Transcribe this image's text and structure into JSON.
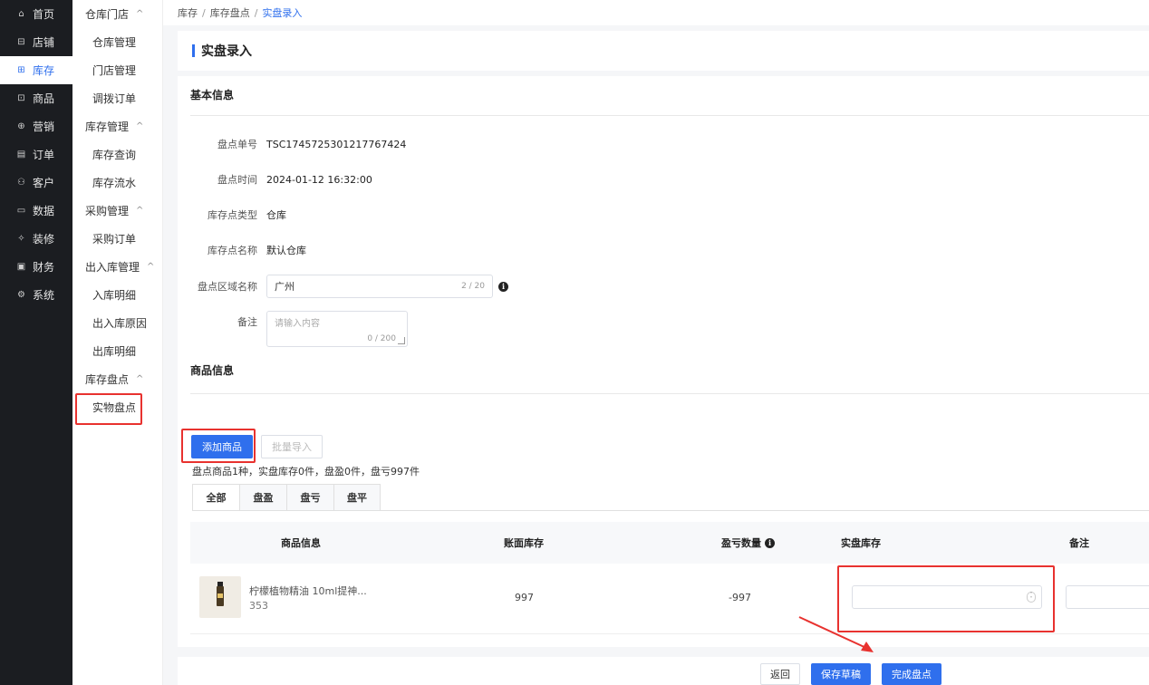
{
  "sidebar": {
    "items": [
      {
        "label": "首页",
        "icon": "home-icon",
        "glyph": "⌂"
      },
      {
        "label": "店铺",
        "icon": "store-icon",
        "glyph": "⊟"
      },
      {
        "label": "库存",
        "icon": "inventory-icon",
        "glyph": "⊞"
      },
      {
        "label": "商品",
        "icon": "goods-icon",
        "glyph": "⊡"
      },
      {
        "label": "营销",
        "icon": "marketing-icon",
        "glyph": "⊕"
      },
      {
        "label": "订单",
        "icon": "order-icon",
        "glyph": "▤"
      },
      {
        "label": "客户",
        "icon": "customer-icon",
        "glyph": "⚇"
      },
      {
        "label": "数据",
        "icon": "data-icon",
        "glyph": "▭"
      },
      {
        "label": "装修",
        "icon": "decorate-icon",
        "glyph": "✧"
      },
      {
        "label": "财务",
        "icon": "finance-icon",
        "glyph": "▣"
      },
      {
        "label": "系统",
        "icon": "system-icon",
        "glyph": "⚙"
      }
    ],
    "active": "库存"
  },
  "subnav": {
    "groups": [
      {
        "label": "仓库门店",
        "items": [
          "仓库管理",
          "门店管理",
          "调拨订单"
        ]
      },
      {
        "label": "库存管理",
        "items": [
          "库存查询",
          "库存流水"
        ]
      },
      {
        "label": "采购管理",
        "items": [
          "采购订单"
        ]
      },
      {
        "label": "出入库管理",
        "items": [
          "入库明细",
          "出入库原因",
          "出库明细"
        ]
      },
      {
        "label": "库存盘点",
        "items": [
          "实物盘点"
        ]
      }
    ],
    "caret": "^",
    "active": "实物盘点"
  },
  "breadcrumb": {
    "items": [
      "库存",
      "库存盘点"
    ],
    "current": "实盘录入",
    "separator": "/"
  },
  "page": {
    "title": "实盘录入"
  },
  "basic": {
    "section_title": "基本信息",
    "order_no_label": "盘点单号",
    "order_no": "TSC1745725301217767424",
    "time_label": "盘点时间",
    "time": "2024-01-12 16:32:00",
    "type_label": "库存点类型",
    "type": "仓库",
    "name_label": "库存点名称",
    "name": "默认仓库",
    "region_label": "盘点区域名称",
    "region_value": "广州",
    "region_count": "2 / 20",
    "remark_label": "备注",
    "remark_placeholder": "请输入内容",
    "remark_count": "0 / 200"
  },
  "goods": {
    "section_title": "商品信息",
    "add_button": "添加商品",
    "import_button": "批量导入",
    "summary": "盘点商品1种，实盘库存0件，盘盈0件，盘亏997件",
    "tabs": [
      "全部",
      "盘盈",
      "盘亏",
      "盘平"
    ],
    "columns": {
      "info": "商品信息",
      "book": "账面库存",
      "diff": "盈亏数量",
      "actual": "实盘库存",
      "remark": "备注"
    },
    "rows": [
      {
        "name": "柠檬植物精油 10ml提神...",
        "code": "353",
        "book_stock": "997",
        "diff_qty": "-997"
      }
    ]
  },
  "footer": {
    "back": "返回",
    "save_draft": "保存草稿",
    "complete": "完成盘点"
  },
  "colors": {
    "primary": "#2f6fed",
    "highlight": "#e8322f",
    "sidebar_bg": "#1b1d21"
  }
}
